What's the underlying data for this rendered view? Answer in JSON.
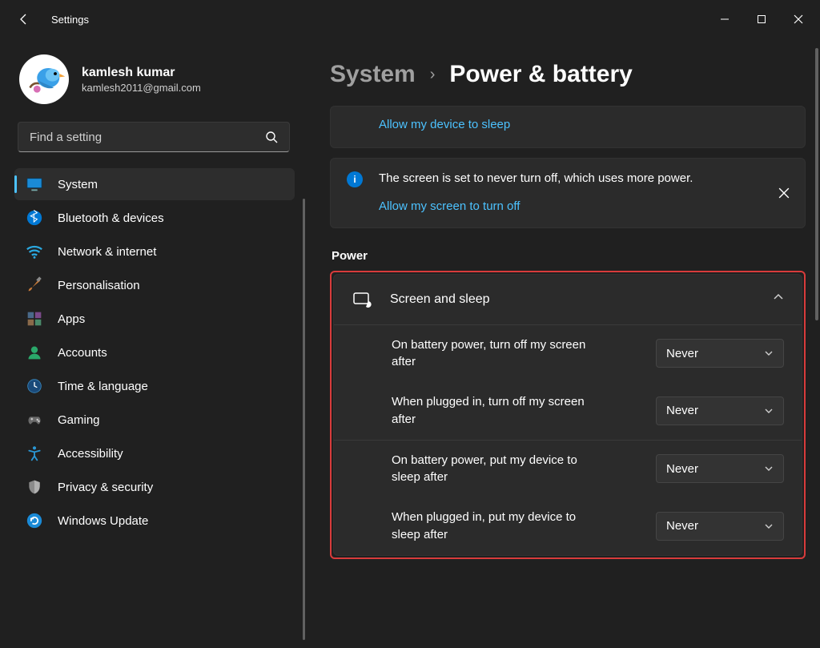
{
  "app_title": "Settings",
  "user": {
    "name": "kamlesh kumar",
    "email": "kamlesh2011@gmail.com"
  },
  "search": {
    "placeholder": "Find a setting"
  },
  "sidebar": {
    "items": [
      {
        "label": "System",
        "icon": "monitor-icon",
        "selected": true
      },
      {
        "label": "Bluetooth & devices",
        "icon": "bluetooth-icon",
        "selected": false
      },
      {
        "label": "Network & internet",
        "icon": "wifi-icon",
        "selected": false
      },
      {
        "label": "Personalisation",
        "icon": "brush-icon",
        "selected": false
      },
      {
        "label": "Apps",
        "icon": "apps-icon",
        "selected": false
      },
      {
        "label": "Accounts",
        "icon": "person-icon",
        "selected": false
      },
      {
        "label": "Time & language",
        "icon": "clock-icon",
        "selected": false
      },
      {
        "label": "Gaming",
        "icon": "gamepad-icon",
        "selected": false
      },
      {
        "label": "Accessibility",
        "icon": "accessibility-icon",
        "selected": false
      },
      {
        "label": "Privacy & security",
        "icon": "shield-icon",
        "selected": false
      },
      {
        "label": "Windows Update",
        "icon": "update-icon",
        "selected": false
      }
    ]
  },
  "breadcrumb": {
    "root": "System",
    "leaf": "Power & battery"
  },
  "banners": {
    "sleep_link": "Allow my device to sleep",
    "screen_text": "The screen is set to never turn off, which uses more power.",
    "screen_link": "Allow my screen to turn off"
  },
  "section": {
    "power_title": "Power"
  },
  "screen_sleep": {
    "title": "Screen and sleep",
    "rows": [
      {
        "label": "On battery power, turn off my screen after",
        "value": "Never"
      },
      {
        "label": "When plugged in, turn off my screen after",
        "value": "Never"
      },
      {
        "label": "On battery power, put my device to sleep after",
        "value": "Never"
      },
      {
        "label": "When plugged in, put my device to sleep after",
        "value": "Never"
      }
    ]
  }
}
